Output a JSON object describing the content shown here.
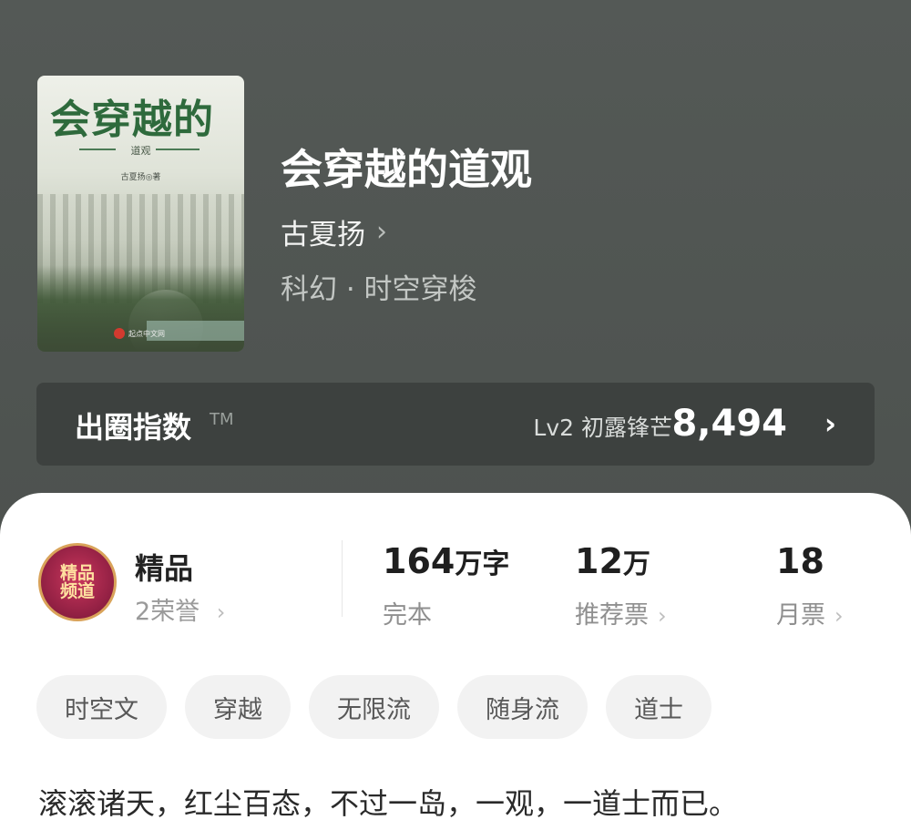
{
  "cover": {
    "title": "会穿越的",
    "subtitle": "道观",
    "author": "古夏扬◎著",
    "logo_text": "起点中文网"
  },
  "book": {
    "title": "会穿越的道观",
    "author": "古夏扬",
    "genre": "科幻 · 时空穿梭"
  },
  "index": {
    "label": "出圈指数",
    "tm": "TM",
    "level": "Lv2 初露锋芒",
    "value": "8,494"
  },
  "honor": {
    "badge_line1": "精品",
    "badge_line2": "频道",
    "title": "精品",
    "subtitle": "2荣誉"
  },
  "stats": [
    {
      "num": "164",
      "unit": "万字",
      "label": "完本"
    },
    {
      "num": "12",
      "unit": "万",
      "label": "推荐票"
    },
    {
      "num": "18",
      "unit": "",
      "label": "月票"
    }
  ],
  "tags": [
    "时空文",
    "穿越",
    "无限流",
    "随身流",
    "道士"
  ],
  "description": "滚滚诸天，红尘百态，不过一岛，一观，一道士而已。",
  "icons": {
    "chevron": "chevron-right-icon"
  }
}
